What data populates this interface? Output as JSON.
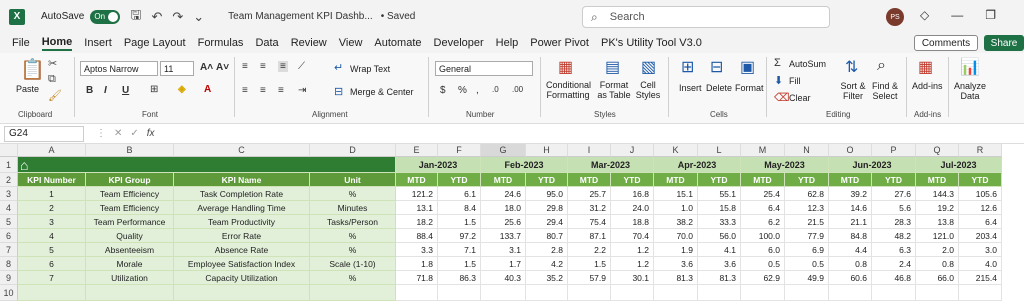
{
  "titlebar": {
    "app_icon": "X",
    "autosave_label": "AutoSave",
    "autosave_state": "On",
    "doc_title": "Team Management KPI Dashb...",
    "saved_state": "• Saved",
    "search_placeholder": "Search",
    "avatar_initials": "PS"
  },
  "menu": [
    "File",
    "Home",
    "Insert",
    "Page Layout",
    "Formulas",
    "Data",
    "Review",
    "View",
    "Automate",
    "Developer",
    "Help",
    "Power Pivot",
    "PK's Utility Tool V3.0"
  ],
  "comments_label": "Comments",
  "share_label": "Share",
  "ribbon": {
    "paste": "Paste",
    "clipboard": "Clipboard",
    "font_name": "Aptos Narrow",
    "font_size": "11",
    "font": "Font",
    "wrap_text": "Wrap Text",
    "merge_center": "Merge & Center",
    "alignment": "Alignment",
    "number_format": "General",
    "number": "Number",
    "conditional_formatting": "Conditional Formatting",
    "format_as_table": "Format as Table",
    "cell_styles": "Cell Styles",
    "styles": "Styles",
    "insert": "Insert",
    "delete": "Delete",
    "format": "Format",
    "cells": "Cells",
    "autosum": "AutoSum",
    "fill": "Fill",
    "clear": "Clear",
    "sort_filter": "Sort & Filter",
    "find_select": "Find & Select",
    "editing": "Editing",
    "add_ins": "Add-ins",
    "add_ins_group": "Add-ins",
    "analyze_data": "Analyze Data"
  },
  "formula_bar": {
    "name_box": "G24",
    "fx": "fx",
    "value": ""
  },
  "columns": [
    "A",
    "B",
    "C",
    "D",
    "E",
    "F",
    "G",
    "H",
    "I",
    "J",
    "K",
    "L",
    "M",
    "N",
    "O",
    "P",
    "Q",
    "R"
  ],
  "rows": [
    "1",
    "2",
    "3",
    "4",
    "5",
    "6",
    "7",
    "8",
    "9",
    "10"
  ],
  "sheet": {
    "months": [
      "Jan-2023",
      "Feb-2023",
      "Mar-2023",
      "Apr-2023",
      "May-2023",
      "Jun-2023",
      "Jul-2023"
    ],
    "headers": [
      "KPI Number",
      "KPI Group",
      "KPI Name",
      "Unit"
    ],
    "mtd": "MTD",
    "ytd": "YTD",
    "kpis": [
      {
        "num": "1",
        "group": "Team Efficiency",
        "name": "Task Completion Rate",
        "unit": "%",
        "vals": [
          "121.2",
          "6.1",
          "24.6",
          "95.0",
          "25.7",
          "16.8",
          "15.1",
          "55.1",
          "25.4",
          "62.8",
          "39.2",
          "27.6",
          "144.3",
          "105.6"
        ]
      },
      {
        "num": "2",
        "group": "Team Efficiency",
        "name": "Average Handling Time",
        "unit": "Minutes",
        "vals": [
          "13.1",
          "8.4",
          "18.0",
          "29.8",
          "31.2",
          "24.0",
          "1.0",
          "15.8",
          "6.4",
          "12.3",
          "14.6",
          "5.6",
          "19.2",
          "12.6"
        ]
      },
      {
        "num": "3",
        "group": "Team Performance",
        "name": "Team Productivity",
        "unit": "Tasks/Person",
        "vals": [
          "18.2",
          "1.5",
          "25.6",
          "29.4",
          "75.4",
          "18.8",
          "38.2",
          "33.3",
          "6.2",
          "21.5",
          "21.1",
          "28.3",
          "13.8",
          "6.4"
        ]
      },
      {
        "num": "4",
        "group": "Quality",
        "name": "Error Rate",
        "unit": "%",
        "vals": [
          "88.4",
          "97.2",
          "133.7",
          "80.7",
          "87.1",
          "70.4",
          "70.0",
          "56.0",
          "100.0",
          "77.9",
          "84.8",
          "48.2",
          "121.0",
          "203.4"
        ]
      },
      {
        "num": "5",
        "group": "Absenteeism",
        "name": "Absence Rate",
        "unit": "%",
        "vals": [
          "3.3",
          "7.1",
          "3.1",
          "2.8",
          "2.2",
          "1.2",
          "1.9",
          "4.1",
          "6.0",
          "6.9",
          "4.4",
          "6.3",
          "2.0",
          "3.0"
        ]
      },
      {
        "num": "6",
        "group": "Morale",
        "name": "Employee Satisfaction Index",
        "unit": "Scale (1-10)",
        "vals": [
          "1.8",
          "1.5",
          "1.7",
          "4.2",
          "1.5",
          "1.2",
          "3.6",
          "3.6",
          "0.5",
          "0.5",
          "0.8",
          "2.4",
          "0.8",
          "4.0"
        ]
      },
      {
        "num": "7",
        "group": "Utilization",
        "name": "Capacity Utilization",
        "unit": "%",
        "vals": [
          "71.8",
          "86.3",
          "40.3",
          "35.2",
          "57.9",
          "30.1",
          "81.3",
          "81.3",
          "62.9",
          "49.9",
          "60.6",
          "46.8",
          "66.0",
          "215.4"
        ]
      }
    ]
  }
}
